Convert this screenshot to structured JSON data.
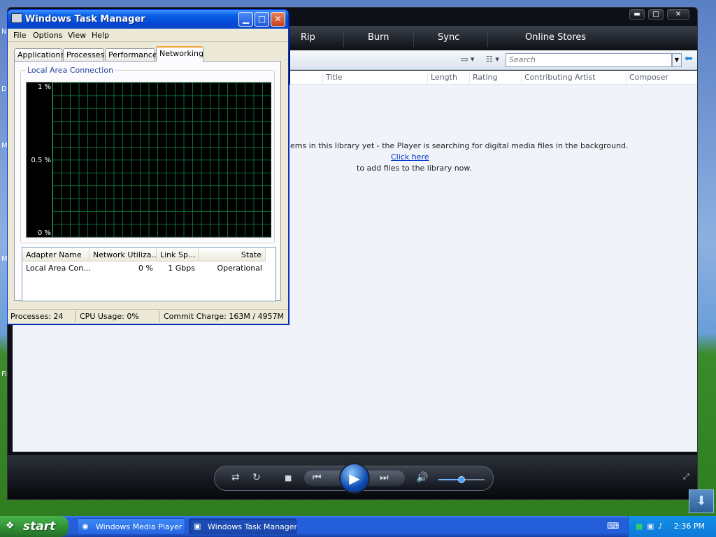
{
  "desktop": {
    "edge_letters": [
      "N",
      "D",
      "M",
      "M",
      "Fi"
    ]
  },
  "media_player": {
    "tabs": [
      "Rip",
      "Burn",
      "Sync",
      "Online Stores"
    ],
    "caption": {
      "minimize": "▬",
      "maximize": "□",
      "close": "✕"
    },
    "search": {
      "placeholder": "Search"
    },
    "columns": [
      "Title",
      "Length",
      "Rating",
      "Contributing Artist",
      "Composer"
    ],
    "message": {
      "line1": "ems in this library yet - the Player is searching for digital media files in the background.",
      "link": "Click here",
      "line2": "to add files to the library now."
    },
    "volume_level": 0.5
  },
  "task_manager": {
    "title": "Windows Task Manager",
    "menu": [
      "File",
      "Options",
      "View",
      "Help"
    ],
    "tabs": [
      "Applications",
      "Processes",
      "Performance",
      "Networking"
    ],
    "selected_tab": "Networking",
    "group_label": "Local Area Connection",
    "graph": {
      "y_labels": [
        "1 %",
        "0.5 %",
        "0 %"
      ]
    },
    "adapters": {
      "headers": [
        "Adapter Name",
        "Network Utiliza...",
        "Link Sp...",
        "State"
      ],
      "rows": [
        {
          "name": "Local Area Con...",
          "utilization": "0 %",
          "speed": "1 Gbps",
          "state": "Operational"
        }
      ]
    },
    "status": {
      "processes": "Processes: 24",
      "cpu": "CPU Usage: 0%",
      "commit": "Commit Charge: 163M / 4957M"
    }
  },
  "taskbar": {
    "start_label": "start",
    "tasks": [
      {
        "label": "Windows Media Player",
        "active": false
      },
      {
        "label": "Windows Task Manager",
        "active": true
      }
    ],
    "clock": "2:36 PM"
  },
  "colors": {
    "xp_title_blue": "#0349d6",
    "graph_grid": "#0c6a36",
    "taskbar_blue": "#245edb",
    "start_green": "#2f8c33"
  }
}
